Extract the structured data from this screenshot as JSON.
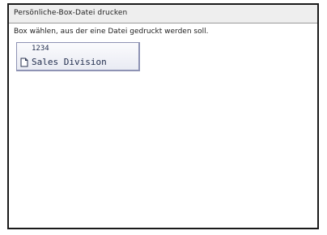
{
  "window": {
    "title": "Persönliche-Box-Datei drucken"
  },
  "main": {
    "instruction": "Box wählen, aus der eine Datei gedruckt werden soll.",
    "boxes": [
      {
        "number": "1234",
        "name": "Sales Division",
        "icon": "document-icon"
      }
    ]
  }
}
